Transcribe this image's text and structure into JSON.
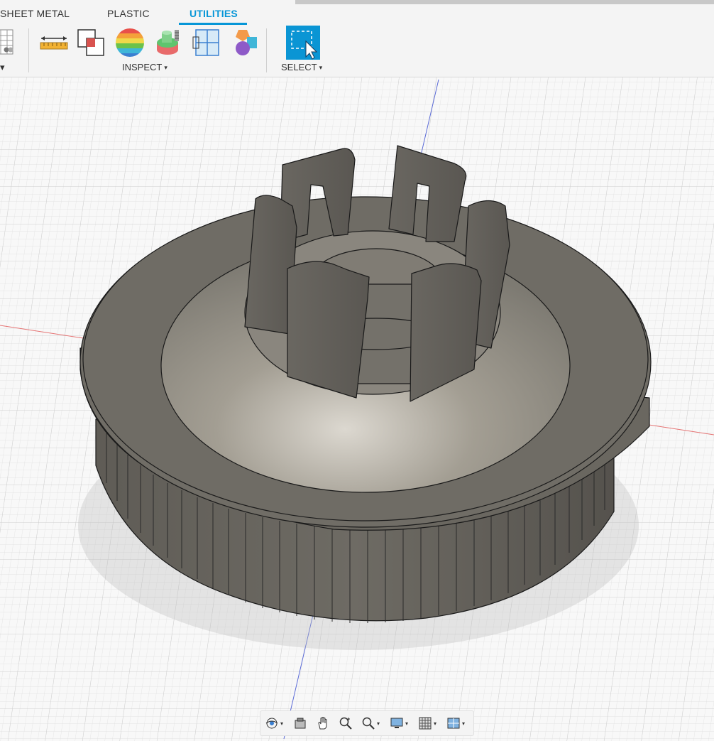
{
  "tabs": [
    {
      "label": "SHEET METAL",
      "active": false
    },
    {
      "label": "PLASTIC",
      "active": false
    },
    {
      "label": "UTILITIES",
      "active": true
    }
  ],
  "groups": {
    "inspect": {
      "label": "INSPECT",
      "caret": "▾"
    },
    "select": {
      "label": "SELECT",
      "caret": "▾"
    },
    "partial": {
      "caret": "▾"
    }
  },
  "inspect_tools": [
    {
      "icon": "measure-icon"
    },
    {
      "icon": "interference-icon"
    },
    {
      "icon": "zebra-analysis-icon"
    },
    {
      "icon": "draft-analysis-icon"
    },
    {
      "icon": "section-analysis-icon"
    },
    {
      "icon": "display-component-colors-icon"
    }
  ],
  "select_tool": {
    "icon": "window-select-icon"
  },
  "navbar": [
    {
      "icon": "orbit-icon",
      "dropdown": true
    },
    {
      "icon": "look-at-icon",
      "dropdown": false
    },
    {
      "icon": "pan-icon",
      "dropdown": false
    },
    {
      "icon": "zoom-icon",
      "dropdown": false
    },
    {
      "icon": "fit-icon",
      "dropdown": true
    },
    {
      "icon": "display-settings-icon",
      "dropdown": true
    },
    {
      "icon": "grid-snap-icon",
      "dropdown": true
    },
    {
      "icon": "viewports-icon",
      "dropdown": true
    }
  ],
  "colors": {
    "accent": "#0696d7",
    "model": "#6b6963",
    "grid": "#d9d9d9",
    "x_axis": "#e06060",
    "y_axis": "#5a6ad6"
  }
}
